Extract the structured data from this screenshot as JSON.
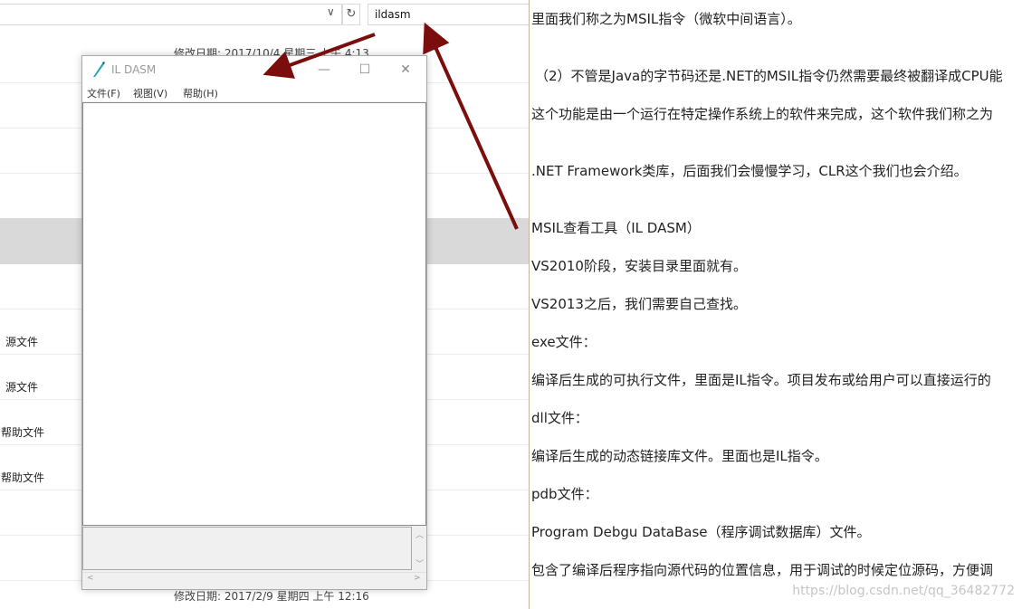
{
  "explorer": {
    "search_value": "ildasm",
    "refresh_icon": "refresh-icon",
    "rows": [
      {
        "label": "修改日期: 2017/10/4 星期三 上午 4:13"
      },
      {
        "label": "源文件"
      },
      {
        "label": "源文件"
      },
      {
        "label": "帮助文件"
      },
      {
        "label": "帮助文件"
      },
      {
        "label": "修改日期: 2017/2/9 星期四 上午 12:16"
      }
    ]
  },
  "ildasm": {
    "title": "IL DASM",
    "menu": [
      "文件(F)",
      "视图(V)",
      "帮助(H)"
    ],
    "controls": {
      "minimize": "—",
      "maximize": "☐",
      "close": "✕"
    }
  },
  "blog": {
    "paragraphs": [
      "里面我们称之为MSIL指令（微软中间语言）。",
      "（2）不管是Java的字节码还是.NET的MSIL指令仍然需要最终被翻译成CPU能",
      "这个功能是由一个运行在特定操作系统上的软件来完成，这个软件我们称之为",
      ".NET Framework类库，后面我们会慢慢学习，CLR这个我们也会介绍。",
      "MSIL查看工具（IL DASM）",
      "VS2010阶段，安装目录里面就有。",
      "VS2013之后，我们需要自己查找。",
      "exe文件：",
      "编译后生成的可执行文件，里面是IL指令。项目发布或给用户可以直接运行的",
      "dll文件：",
      "编译后生成的动态链接库文件。里面也是IL指令。",
      "pdb文件：",
      "Program Debgu DataBase（程序调试数据库）文件。",
      "包含了编译后程序指向源代码的位置信息，用于调试的时候定位源码，方便调"
    ],
    "watermark": "https://blog.csdn.net/qq_36482772"
  },
  "colors": {
    "arrow": "#7b0d0d",
    "selection": "#d9d9d9"
  }
}
